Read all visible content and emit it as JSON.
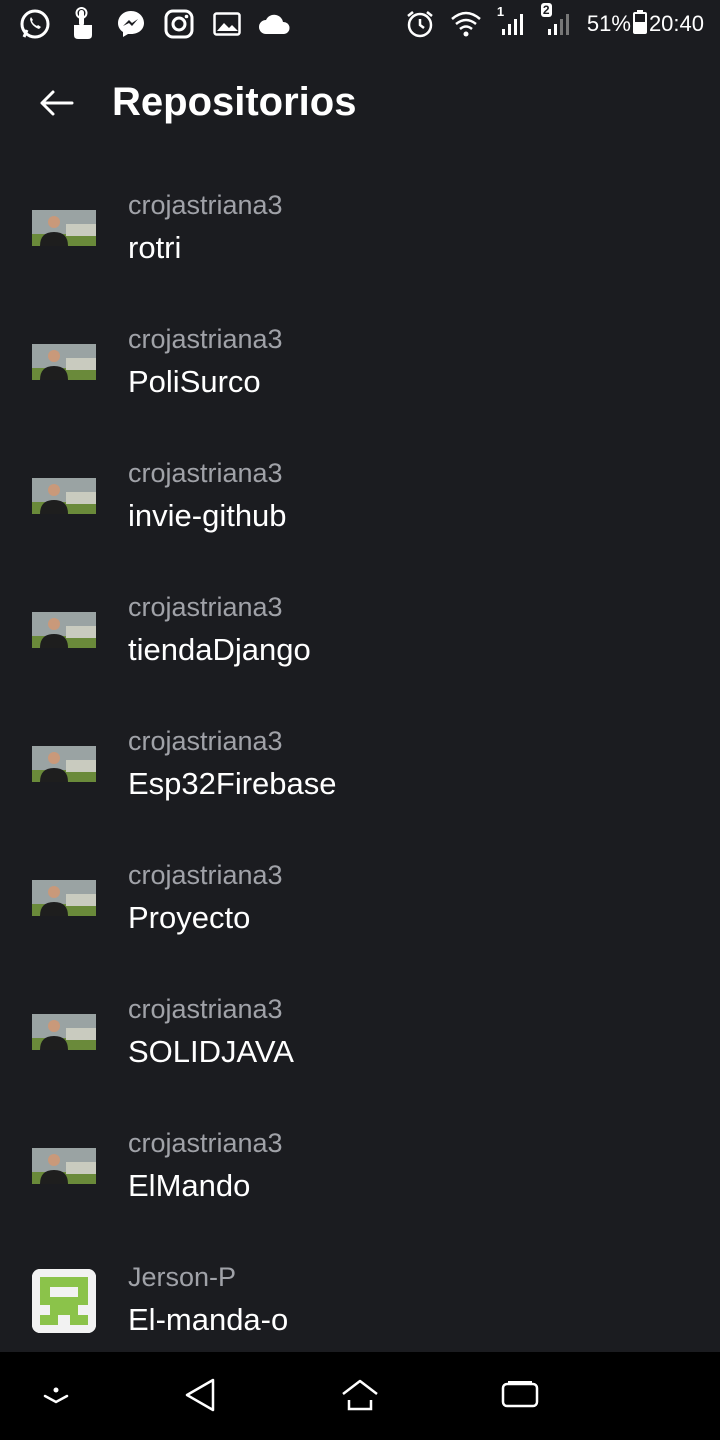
{
  "status_bar": {
    "left_icons": [
      "whatsapp-icon",
      "hand-touch-icon",
      "messenger-icon",
      "instagram-icon",
      "gallery-icon",
      "cloud-icon"
    ],
    "right_icons": [
      "alarm-icon",
      "wifi-icon",
      "signal-sim1-icon",
      "signal-sim2-icon",
      "battery-icon"
    ],
    "sim1_label": "1",
    "sim2_label": "2",
    "battery": "51%",
    "time": "20:40"
  },
  "header": {
    "back_icon": "arrow-left-icon",
    "title": "Repositorios"
  },
  "repositories": [
    {
      "owner": "crojastriana3",
      "name": "rotri"
    },
    {
      "owner": "crojastriana3",
      "name": "PoliSurco"
    },
    {
      "owner": "crojastriana3",
      "name": "invie-github"
    },
    {
      "owner": "crojastriana3",
      "name": "tiendaDjango"
    },
    {
      "owner": "crojastriana3",
      "name": "Esp32Firebase"
    },
    {
      "owner": "crojastriana3",
      "name": "Proyecto"
    },
    {
      "owner": "crojastriana3",
      "name": "SOLIDJAVA"
    },
    {
      "owner": "crojastriana3",
      "name": "ElMando"
    },
    {
      "owner": "Jerson-P",
      "name": "El-manda-o"
    }
  ],
  "nav_bar": {
    "icons": [
      "hide-keyboard-icon",
      "back-triangle-icon",
      "home-icon",
      "recents-icon"
    ]
  },
  "colors": {
    "background": "#1b1c20",
    "owner_text": "#a0a2a8",
    "name_text": "#ffffff",
    "identicon_green": "#8bc34a"
  }
}
